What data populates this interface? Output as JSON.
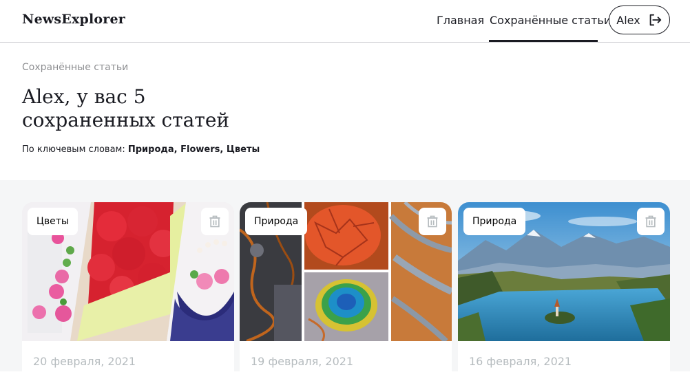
{
  "header": {
    "logo": "NewsExplorer",
    "nav": {
      "home": "Главная",
      "saved": "Сохранённые статьи"
    },
    "user": {
      "name": "Alex",
      "icon": "logout-icon"
    }
  },
  "info": {
    "breadcrumb": "Сохранённые статьи",
    "title_line1": "Alex, у вас 5",
    "title_line2": "сохраненных статей",
    "keywords_label": "По ключевым словам: ",
    "keywords_value": "Природа, Flowers, Цветы"
  },
  "cards": [
    {
      "tag": "Цветы",
      "date": "20 февраля, 2021",
      "image": "paper-flowers-collage",
      "icon": "trash-icon"
    },
    {
      "tag": "Природа",
      "date": "19 февраля, 2021",
      "image": "aerial-nature-collage",
      "icon": "trash-icon"
    },
    {
      "tag": "Природа",
      "date": "16 февраля, 2021",
      "image": "mountain-lake-landscape",
      "icon": "trash-icon"
    }
  ],
  "colors": {
    "text": "#1a1b22",
    "muted": "#b6bcbf",
    "section_bg": "#f5f6f7",
    "border": "#d1d2d6"
  }
}
